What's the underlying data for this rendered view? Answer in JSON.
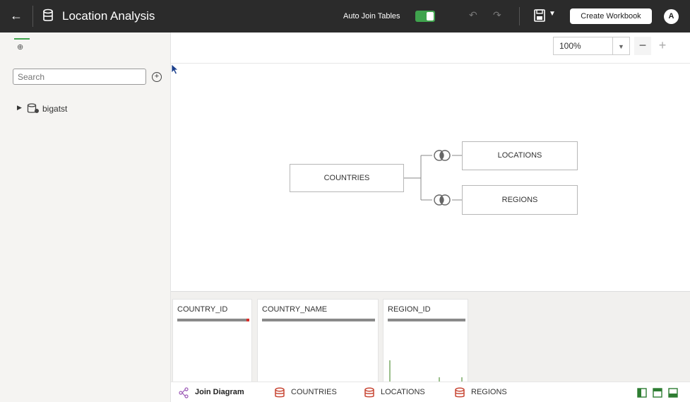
{
  "header": {
    "back_icon": "arrow-left-icon",
    "title": "Location Analysis",
    "auto_join_label": "Auto Join Tables",
    "auto_join_on": true,
    "create_workbook_label": "Create Workbook",
    "avatar_initial": "A"
  },
  "sidebar": {
    "search_placeholder": "Search",
    "tree": [
      {
        "label": "bigatst"
      }
    ]
  },
  "zoom": {
    "value": "100%",
    "minus": "−",
    "plus": "+"
  },
  "diagram": {
    "nodes": {
      "countries": "COUNTRIES",
      "locations": "LOCATIONS",
      "regions": "REGIONS"
    }
  },
  "columns": [
    {
      "name": "COUNTRY_ID"
    },
    {
      "name": "COUNTRY_NAME"
    },
    {
      "name": "REGION_ID"
    }
  ],
  "tabs": [
    {
      "label": "Join Diagram",
      "active": true
    },
    {
      "label": "COUNTRIES"
    },
    {
      "label": "LOCATIONS"
    },
    {
      "label": "REGIONS"
    }
  ],
  "colors": {
    "header_bg": "#2b2b2b",
    "accent_green": "#3fa34d",
    "dataset_red": "#c74634"
  }
}
